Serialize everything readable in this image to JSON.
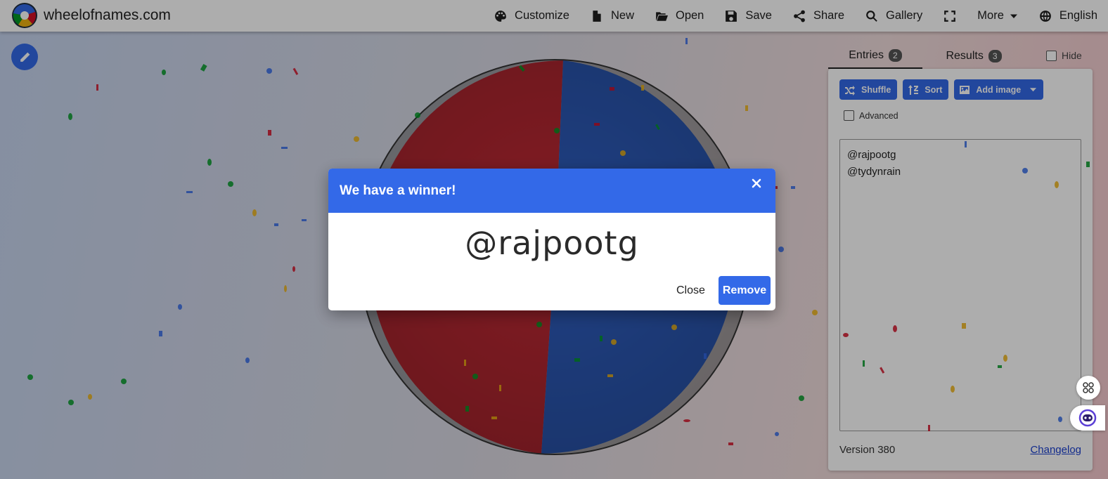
{
  "app": {
    "site_name": "wheelofnames.com",
    "logo_icon": "wheel-logo-icon"
  },
  "nav": {
    "items": [
      {
        "label": "Customize",
        "icon": "palette-icon"
      },
      {
        "label": "New",
        "icon": "file-icon"
      },
      {
        "label": "Open",
        "icon": "folder-open-icon"
      },
      {
        "label": "Save",
        "icon": "save-icon"
      },
      {
        "label": "Share",
        "icon": "share-icon"
      },
      {
        "label": "Gallery",
        "icon": "search-icon"
      },
      {
        "label": "",
        "icon": "fullscreen-icon"
      },
      {
        "label": "More",
        "icon": "chevron-down-icon"
      },
      {
        "label": "English",
        "icon": "globe-icon"
      }
    ]
  },
  "wheel": {
    "colors": [
      "#c22a35",
      "#2f5fc3"
    ],
    "segments": [
      "@rajpootg",
      "@tydynrain"
    ]
  },
  "panel": {
    "tabs": [
      {
        "label": "Entries",
        "count": "2"
      },
      {
        "label": "Results",
        "count": "3"
      }
    ],
    "hide_label": "Hide",
    "buttons": {
      "shuffle": "Shuffle",
      "sort": "Sort",
      "add_image": "Add image"
    },
    "advanced_label": "Advanced",
    "entries": [
      "@rajpootg",
      "@tydynrain"
    ],
    "version": "Version 380",
    "changelog": "Changelog"
  },
  "dialog": {
    "title": "We have a winner!",
    "winner": "@rajpootg",
    "close_label": "Close",
    "remove_label": "Remove"
  },
  "colors": {
    "accent": "#3369e8",
    "wheel_red": "#c22a35",
    "wheel_blue": "#2f5fc3"
  }
}
